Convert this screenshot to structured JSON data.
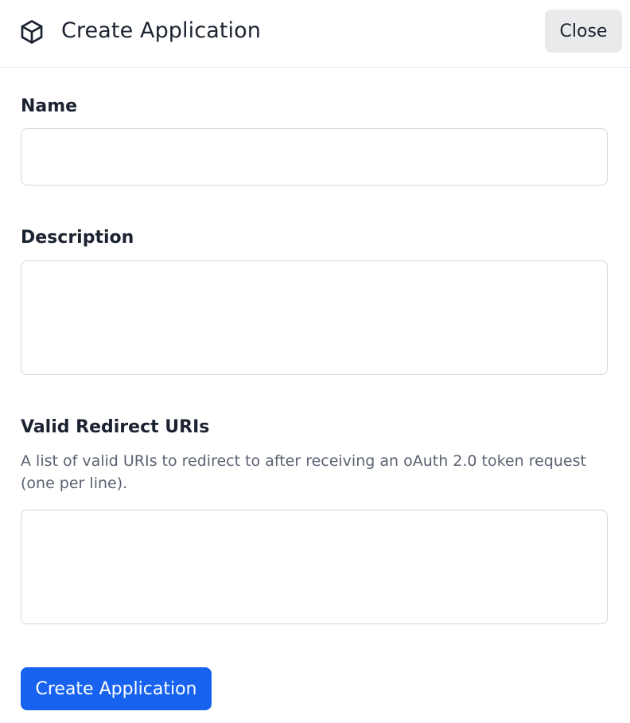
{
  "header": {
    "icon": "cube-icon",
    "title": "Create Application",
    "close_label": "Close"
  },
  "form": {
    "name": {
      "label": "Name",
      "value": "",
      "placeholder": ""
    },
    "description": {
      "label": "Description",
      "value": "",
      "placeholder": ""
    },
    "redirect_uris": {
      "label": "Valid Redirect URIs",
      "help": "A list of valid URIs to redirect to after receiving an oAuth 2.0 token request (one per line).",
      "value": "",
      "placeholder": ""
    },
    "submit_label": "Create Application"
  },
  "colors": {
    "primary": "#1763f0",
    "close_bg": "#e9eaec",
    "text": "#1b2230",
    "muted_text": "#5b6272",
    "border": "#d4d7dd"
  }
}
